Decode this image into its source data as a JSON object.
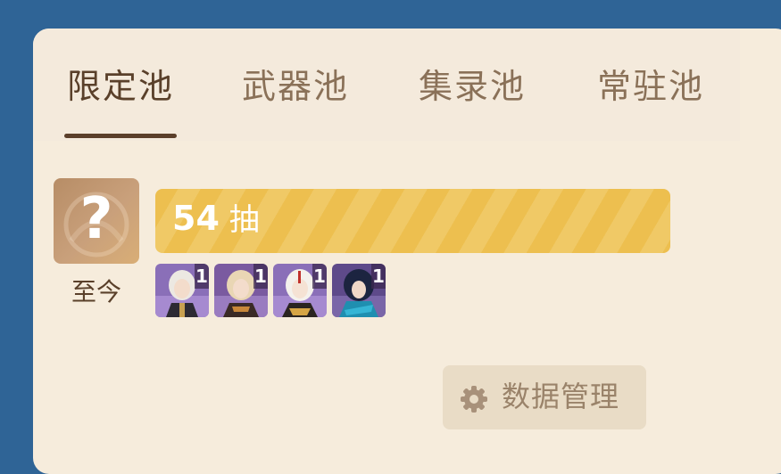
{
  "tabs": [
    {
      "label": "限定池",
      "active": true
    },
    {
      "label": "武器池",
      "active": false
    },
    {
      "label": "集录池",
      "active": false
    },
    {
      "label": "常驻池",
      "active": false
    }
  ],
  "pool": {
    "avatar_text": "?",
    "since_label": "至今",
    "pull_count": "54",
    "pull_unit": "抽"
  },
  "characters": [
    {
      "name": "character-portrait-1",
      "count": "1"
    },
    {
      "name": "character-portrait-2",
      "count": "1"
    },
    {
      "name": "character-portrait-3",
      "count": "1"
    },
    {
      "name": "character-portrait-4",
      "count": "1"
    }
  ],
  "manage_button": {
    "label": "数据管理",
    "icon": "gear-icon"
  },
  "colors": {
    "background": "#2f6496",
    "panel": "#f6ecdc",
    "accent_bar": "#edbf4f",
    "tab_active": "#5a402a",
    "tab_inactive": "#8a7158"
  }
}
